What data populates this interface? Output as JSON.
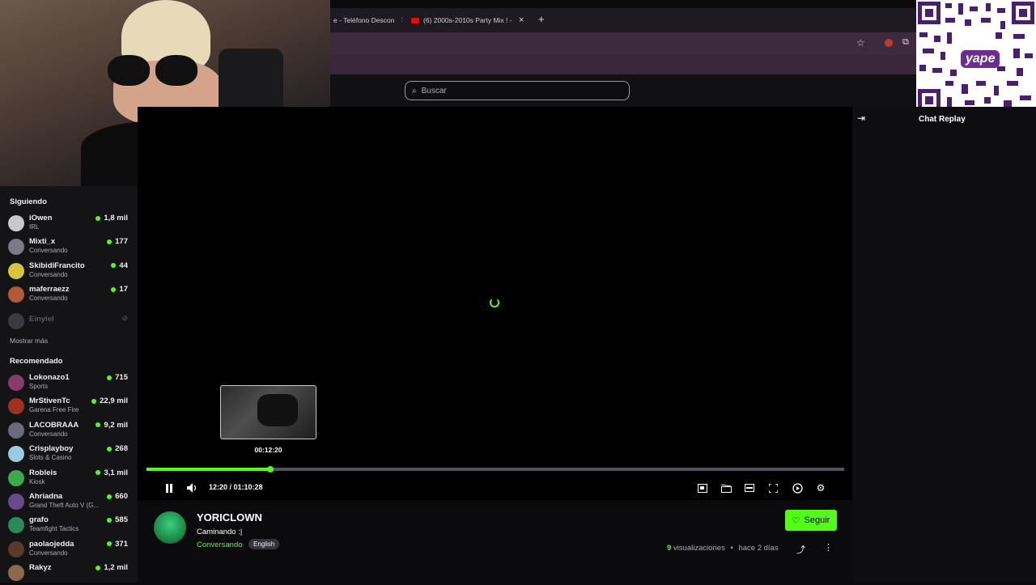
{
  "browser": {
    "tabs": [
      {
        "label": "e - Teléfono Descon"
      },
      {
        "label": "(6) 2000s-2010s Party Mix ! - Yo"
      }
    ],
    "new_tab_glyph": "+"
  },
  "search": {
    "placeholder": "Buscar"
  },
  "sidebar": {
    "following_heading": "Siguiendo",
    "following": [
      {
        "name": "iOwen",
        "sub": "IRL",
        "viewers": "1,8 mil",
        "color": "#c9c9c9"
      },
      {
        "name": "Mixti_x",
        "sub": "Conversando",
        "viewers": "177",
        "color": "#7a7a88"
      },
      {
        "name": "SkibidiFrancito",
        "sub": "Conversando",
        "viewers": "44",
        "color": "#d9c53a"
      },
      {
        "name": "maferraezz",
        "sub": "Conversando",
        "viewers": "17",
        "color": "#b05a3a"
      }
    ],
    "offline": {
      "name": "Einyiel"
    },
    "show_more": "Mostrar más",
    "recommended_heading": "Recomendado",
    "recommended": [
      {
        "name": "Lokonazo1",
        "sub": "Sports",
        "viewers": "715",
        "color": "#8a3a6a"
      },
      {
        "name": "MrStivenTc",
        "sub": "Garena Free Fire",
        "viewers": "22,9 mil",
        "color": "#a03020"
      },
      {
        "name": "LACOBRAAA",
        "sub": "Conversando",
        "viewers": "9,2 mil",
        "color": "#6a6a7a"
      },
      {
        "name": "Crisplayboy",
        "sub": "Slots & Casino",
        "viewers": "268",
        "color": "#9acbe0"
      },
      {
        "name": "Robleis",
        "sub": "Kiosk",
        "viewers": "3,1 mil",
        "color": "#3aaa4a"
      },
      {
        "name": "Ahriadna",
        "sub": "Grand Theft Auto V (G...",
        "viewers": "660",
        "color": "#6a4a8a"
      },
      {
        "name": "grafo",
        "sub": "Teamfight Tactics",
        "viewers": "585",
        "color": "#2a8a5a"
      },
      {
        "name": "paolaojedda",
        "sub": "Conversando",
        "viewers": "371",
        "color": "#5a3a2a"
      },
      {
        "name": "Rakyz",
        "sub": "",
        "viewers": "1,2 mil",
        "color": "#8a6a4a"
      }
    ]
  },
  "player": {
    "progress_fraction": 0.178,
    "preview_time": "00:12:20",
    "current_time": "12:20",
    "duration": "01:10:28",
    "time_display": "12:20 / 01:10:28"
  },
  "stream": {
    "name": "YORICLOWN",
    "title": "Caminando :|",
    "category": "Conversando",
    "language": "English",
    "follow_label": "Seguir",
    "views_count": "9",
    "views_label": "visualizaciones",
    "separator": "•",
    "age": "hace 2 días"
  },
  "chat": {
    "title": "Chat Replay"
  },
  "overlay": {
    "qr_brand": "yape"
  },
  "colors": {
    "accent": "#53fc18",
    "background": "#0b0b0d",
    "sidebar": "#141416"
  }
}
